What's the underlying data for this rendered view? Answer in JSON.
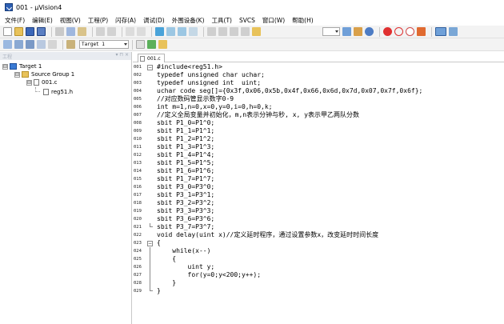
{
  "window": {
    "title": "001 - µVision4"
  },
  "menu": [
    "文件(F)",
    "编辑(E)",
    "视图(V)",
    "工程(P)",
    "闪存(A)",
    "调试(D)",
    "外围设备(K)",
    "工具(T)",
    "SVCS",
    "窗口(W)",
    "帮助(H)"
  ],
  "toolbar": {
    "target_select": "Target 1"
  },
  "project_panel": {
    "title": "工程",
    "controls": "▾ ⊓ ×",
    "tree": [
      {
        "label": "Target 1",
        "toggle": "⊟"
      },
      {
        "label": "Source Group 1",
        "toggle": "⊟"
      },
      {
        "label": "001.c",
        "toggle": "⊟"
      },
      {
        "label": "reg51.h",
        "toggle": ""
      }
    ]
  },
  "editor": {
    "tab": "001.c",
    "lines": [
      {
        "num": "001",
        "text": "#include<reg51.h>"
      },
      {
        "num": "002",
        "text": "typedef unsigned char uchar;"
      },
      {
        "num": "003",
        "text": "typedef unsigned int  uint;"
      },
      {
        "num": "004",
        "text": "uchar code seg[]={0x3f,0x06,0x5b,0x4f,0x66,0x6d,0x7d,0x07,0x7f,0x6f};"
      },
      {
        "num": "005",
        "text": "//对应数码管显示数字0-9"
      },
      {
        "num": "006",
        "text": "int m=1,n=0,x=0,y=0,i=0,h=0,k;"
      },
      {
        "num": "007",
        "text": "//定义全局变量并初始化，m,n表示分钟与秒, x, y表示甲乙两队分数"
      },
      {
        "num": "008",
        "text": "sbit P1_0=P1^0;"
      },
      {
        "num": "009",
        "text": "sbit P1_1=P1^1;"
      },
      {
        "num": "010",
        "text": "sbit P1_2=P1^2;"
      },
      {
        "num": "011",
        "text": "sbit P1_3=P1^3;"
      },
      {
        "num": "012",
        "text": "sbit P1_4=P1^4;"
      },
      {
        "num": "013",
        "text": "sbit P1_5=P1^5;"
      },
      {
        "num": "014",
        "text": "sbit P1_6=P1^6;"
      },
      {
        "num": "015",
        "text": "sbit P1_7=P1^7;"
      },
      {
        "num": "016",
        "text": "sbit P3_0=P3^0;"
      },
      {
        "num": "017",
        "text": "sbit P3_1=P3^1;"
      },
      {
        "num": "018",
        "text": "sbit P3_2=P3^2;"
      },
      {
        "num": "019",
        "text": "sbit P3_3=P3^3;"
      },
      {
        "num": "020",
        "text": "sbit P3_6=P3^6;"
      },
      {
        "num": "021",
        "text": "sbit P3_7=P3^7;"
      },
      {
        "num": "022",
        "text": "void delay(uint x)//定义延时程序，通过设置参数x，改变延时时间长度"
      },
      {
        "num": "023",
        "text": "{"
      },
      {
        "num": "024",
        "text": "    while(x--)"
      },
      {
        "num": "025",
        "text": "    {"
      },
      {
        "num": "026",
        "text": "        uint y;"
      },
      {
        "num": "027",
        "text": "        for(y=0;y<200;y++);"
      },
      {
        "num": "028",
        "text": "    }"
      },
      {
        "num": "029",
        "text": "}"
      }
    ]
  },
  "colors": {
    "toolbar_bg": "#f3f3f3",
    "panel_header_bg": "#e8ebf0",
    "folder": "#e8c25a",
    "target_icon": "#3a7bd5"
  }
}
